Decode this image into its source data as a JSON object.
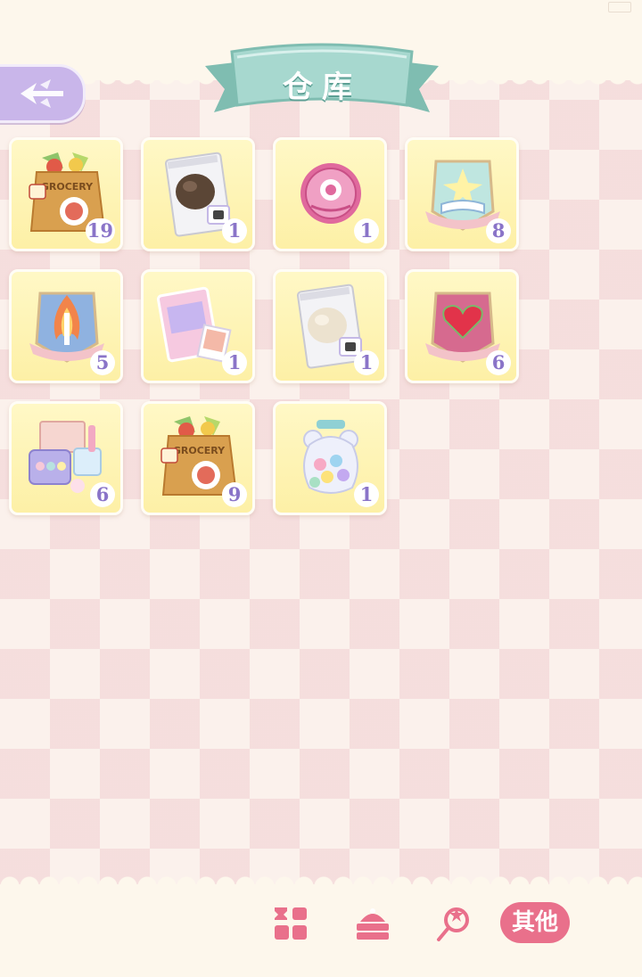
{
  "header": {
    "title": "仓库",
    "back_icon": "winged-arrow-back-icon"
  },
  "inventory": {
    "items": [
      {
        "icon": "grocery-bag-icon",
        "count": "19"
      },
      {
        "icon": "dark-wig-packet-icon",
        "count": "1"
      },
      {
        "icon": "pink-badge-tin-icon",
        "count": "1"
      },
      {
        "icon": "book-emblem-icon",
        "count": "8"
      },
      {
        "icon": "flame-sword-emblem-icon",
        "count": "5"
      },
      {
        "icon": "photo-card-pack-icon",
        "count": "1"
      },
      {
        "icon": "light-wig-packet-icon",
        "count": "1"
      },
      {
        "icon": "heart-emblem-icon",
        "count": "6"
      },
      {
        "icon": "makeup-palette-set-icon",
        "count": "6"
      },
      {
        "icon": "grocery-bag-icon",
        "count": "9"
      },
      {
        "icon": "candy-bear-jar-icon",
        "count": "1"
      }
    ]
  },
  "tabs": [
    {
      "icon": "grid-category-icon"
    },
    {
      "icon": "cake-icon"
    },
    {
      "icon": "magic-wand-icon"
    },
    {
      "label": "其他",
      "active": true
    }
  ],
  "colors": {
    "accent_pink": "#e9708b",
    "ribbon_teal": "#9ed0c8",
    "count_purple": "#8a74c8",
    "back_purple": "#c9b6ea"
  }
}
